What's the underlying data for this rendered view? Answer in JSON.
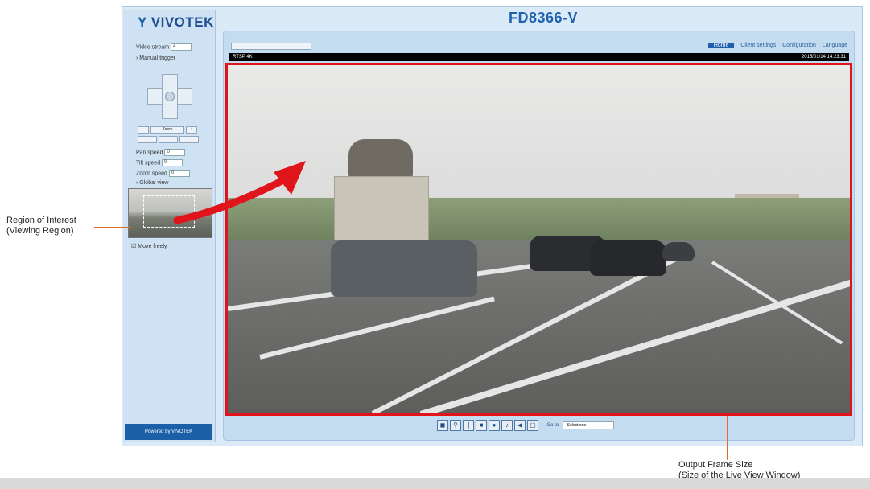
{
  "annotations": {
    "left_line1": "Region of Interest",
    "left_line2": "(Viewing Region)",
    "bottom_line1": "Output Frame Size",
    "bottom_line2": "(Size of the Live View Window)"
  },
  "brand": "VIVOTEK",
  "model": "FD8366-V",
  "sidebar": {
    "video_stream_label": "Video stream",
    "video_stream_value": "4",
    "manual_trigger": "Manual trigger",
    "zoom_label": "Zoom",
    "pan_speed_label": "Pan speed",
    "pan_speed_value": "0",
    "tilt_speed_label": "Tilt speed",
    "tilt_speed_value": "0",
    "zoom_speed_label": "Zoom speed",
    "zoom_speed_value": "0",
    "global_view": "Global view",
    "move_freely": "Move freely",
    "powered_by": "Powered by VIVOTEK"
  },
  "nav": {
    "home": "Home",
    "client_settings": "Client settings",
    "configuration": "Configuration",
    "language": "Language"
  },
  "infobar": {
    "left": "RTSP 4K",
    "right": "2015/01/14 14:23:31"
  },
  "controls": {
    "goto_label": "Go to",
    "goto_value": "- Select one -"
  },
  "colors": {
    "roi_frame": "#e0151b",
    "annotation_line": "#e06a2a",
    "brand_blue": "#1f63b0"
  }
}
